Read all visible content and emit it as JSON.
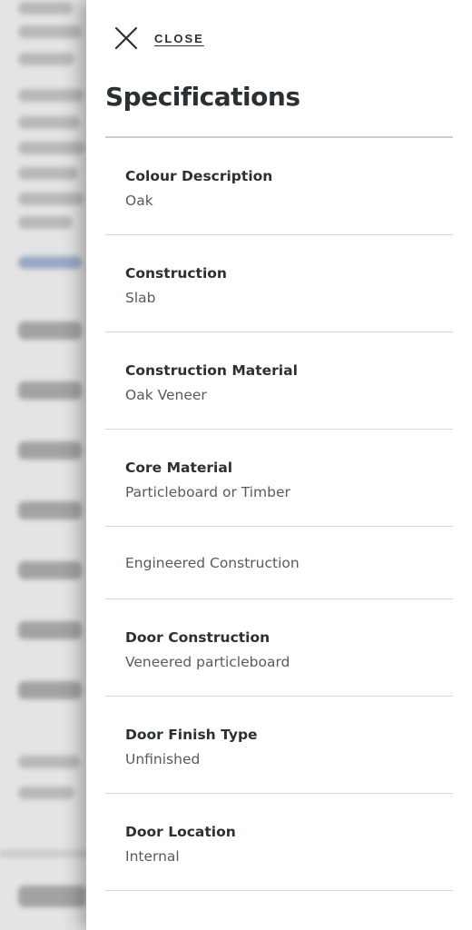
{
  "drawer": {
    "close_label": "CLOSE",
    "title": "Specifications"
  },
  "specs": [
    {
      "label": "Colour Description",
      "value": "Oak"
    },
    {
      "label": "Construction",
      "value": "Slab"
    },
    {
      "label": "Construction Material",
      "value": "Oak Veneer"
    },
    {
      "label": "Core Material",
      "value": "Particleboard or Timber"
    },
    {
      "label": "",
      "value": "Engineered Construction"
    },
    {
      "label": "Door Construction",
      "value": "Veneered particleboard"
    },
    {
      "label": "Door Finish Type",
      "value": "Unfinished"
    },
    {
      "label": "Door Location",
      "value": "Internal"
    }
  ],
  "icons": {
    "close": "close-icon"
  },
  "colors": {
    "text_dark": "#2b3033",
    "text_muted": "#555b60",
    "divider": "#d6d9dc",
    "overlay_bg": "#e4e4e4"
  }
}
